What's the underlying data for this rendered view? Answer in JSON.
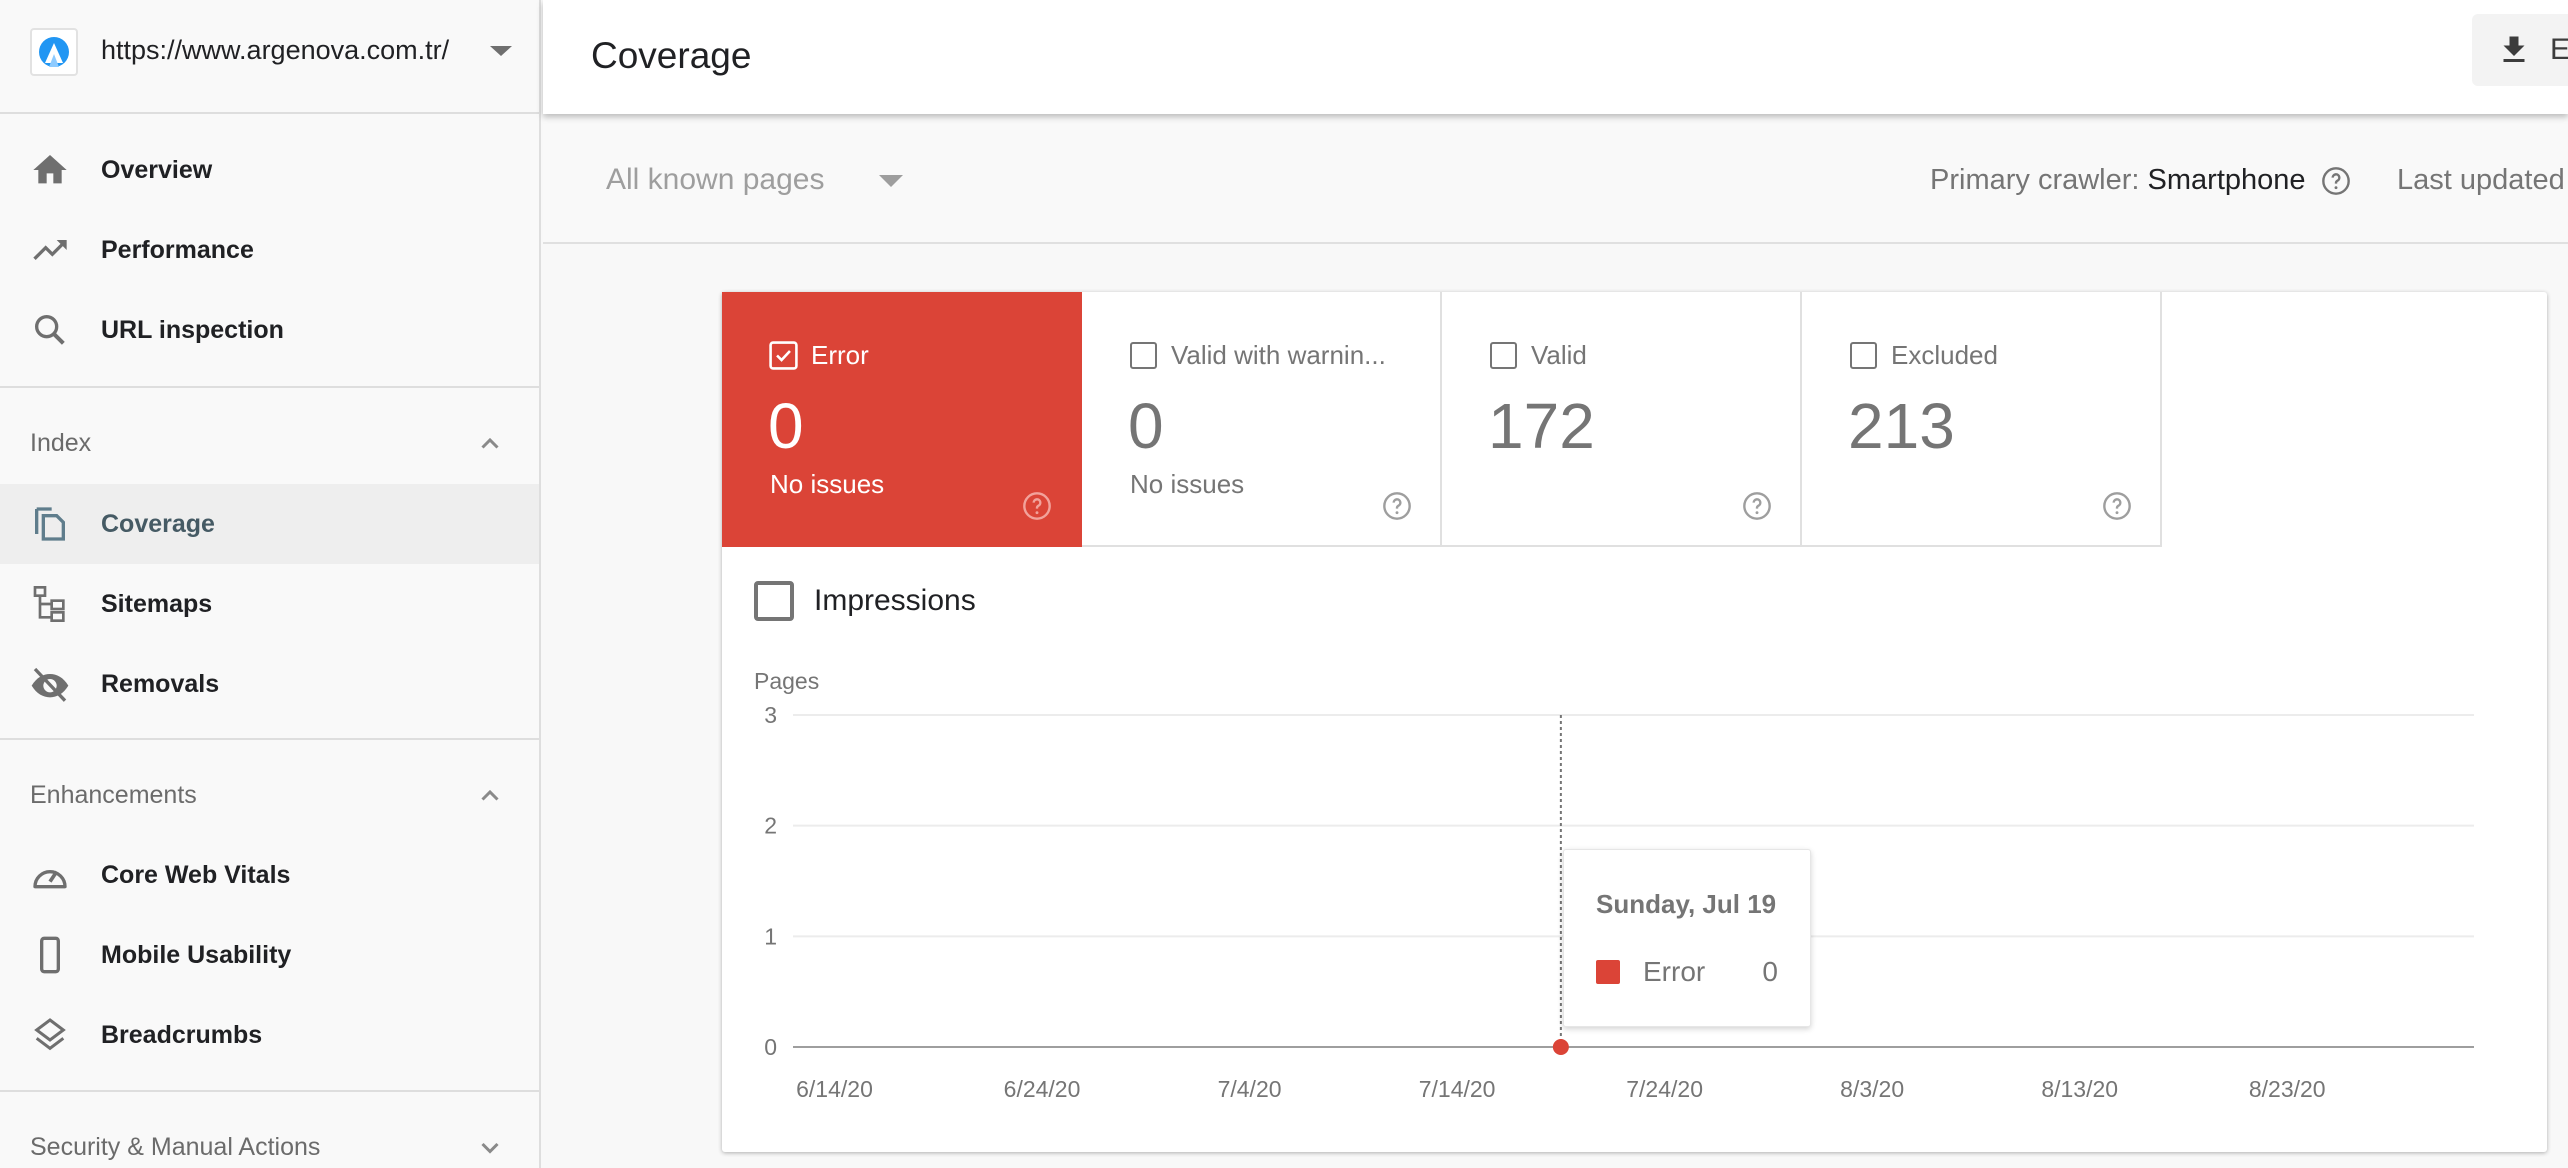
{
  "property": {
    "url": "https://www.argenova.com.tr/",
    "logo_color": "#2196f3"
  },
  "sidebar": {
    "top_items": [
      {
        "label": "Overview",
        "icon": "home-icon"
      },
      {
        "label": "Performance",
        "icon": "trending-up-icon"
      },
      {
        "label": "URL inspection",
        "icon": "search-icon"
      }
    ],
    "sections": [
      {
        "label": "Index",
        "expanded": true,
        "items": [
          {
            "label": "Coverage",
            "icon": "coverage-icon",
            "active": true
          },
          {
            "label": "Sitemaps",
            "icon": "sitemap-icon"
          },
          {
            "label": "Removals",
            "icon": "eye-off-icon"
          }
        ]
      },
      {
        "label": "Enhancements",
        "expanded": true,
        "items": [
          {
            "label": "Core Web Vitals",
            "icon": "speedometer-icon"
          },
          {
            "label": "Mobile Usability",
            "icon": "smartphone-icon"
          },
          {
            "label": "Breadcrumbs",
            "icon": "layers-icon"
          }
        ]
      },
      {
        "label": "Security & Manual Actions",
        "expanded": false,
        "items": []
      }
    ]
  },
  "header": {
    "title": "Coverage",
    "export_label": "E"
  },
  "filter": {
    "selected": "All known pages",
    "crawler_label": "Primary crawler:",
    "crawler_value": "Smartphone",
    "last_updated_label": "Last updated"
  },
  "tiles": [
    {
      "label": "Error",
      "value": "0",
      "sub": "No issues",
      "checked": true,
      "color": "#db4437"
    },
    {
      "label": "Valid with warnin...",
      "value": "0",
      "sub": "No issues",
      "checked": false
    },
    {
      "label": "Valid",
      "value": "172",
      "sub": "",
      "checked": false
    },
    {
      "label": "Excluded",
      "value": "213",
      "sub": "",
      "checked": false
    }
  ],
  "impressions": {
    "label": "Impressions",
    "checked": false
  },
  "tooltip": {
    "date": "Sunday, Jul 19",
    "series": "Error",
    "value": "0"
  },
  "chart_data": {
    "type": "line",
    "title": "",
    "ylabel": "Pages",
    "xlabel": "",
    "ylim": [
      0,
      3
    ],
    "yticks": [
      "0",
      "1",
      "2",
      "3"
    ],
    "grid": true,
    "x_range": [
      "6/12/20",
      "9/1/20"
    ],
    "xticks": [
      "6/14/20",
      "6/24/20",
      "7/4/20",
      "7/14/20",
      "7/24/20",
      "8/3/20",
      "8/13/20",
      "8/23/20"
    ],
    "series": [
      {
        "name": "Error",
        "color": "#db4437",
        "values_note": "constant zero across the range",
        "points": [
          [
            "6/12/20",
            0
          ],
          [
            "9/1/20",
            0
          ]
        ]
      }
    ],
    "highlight": {
      "x": "7/19/20",
      "y": 0,
      "series": "Error"
    }
  }
}
